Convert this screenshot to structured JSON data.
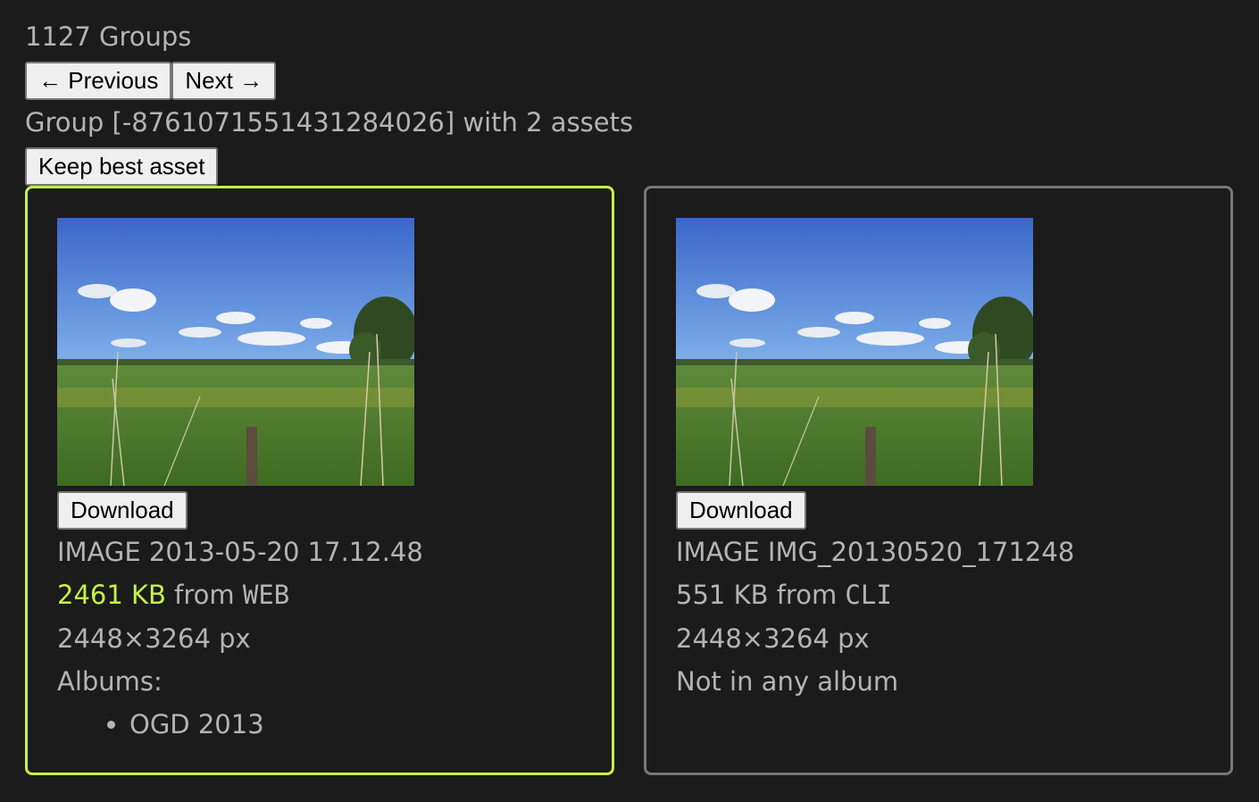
{
  "groups_count": "1127 Groups",
  "nav": {
    "previous_label": "← Previous",
    "next_label": "Next →"
  },
  "group_title": "Group [-8761071551431284026] with 2 assets",
  "keep_best_label": "Keep best asset",
  "colors": {
    "best_border": "#c6f24a",
    "other_border": "#777777",
    "background": "#1b1b1b"
  },
  "assets": [
    {
      "download_label": "Download",
      "name": "IMAGE 2013-05-20 17.12.48",
      "size": "2461 KB",
      "from_word": "from",
      "source": "WEB",
      "dimensions": "2448×3264 px",
      "albums_label": "Albums:",
      "albums": [
        "OGD 2013"
      ],
      "is_best": true
    },
    {
      "download_label": "Download",
      "name": "IMAGE IMG_20130520_171248",
      "size": "551 KB",
      "from_word": "from",
      "source": "CLI",
      "dimensions": "2448×3264 px",
      "albums_label": "Not in any album",
      "is_best": false
    }
  ]
}
